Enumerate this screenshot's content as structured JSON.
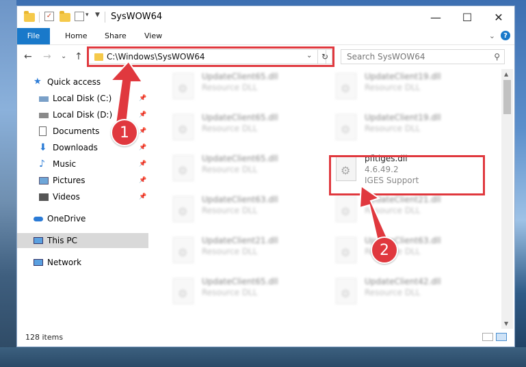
{
  "window": {
    "title": "SysWOW64",
    "minimize": "—",
    "maximize": "☐",
    "close": "✕"
  },
  "ribbon": {
    "tabs": [
      "File",
      "Home",
      "Share",
      "View"
    ],
    "expand": "⌄",
    "help": "?"
  },
  "nav": {
    "back": "←",
    "forward": "→",
    "recent": "⌄",
    "up": "↑",
    "address": "C:\\Windows\\SysWOW64",
    "address_dropdown": "⌄",
    "refresh": "↻",
    "search_placeholder": "Search SysWOW64",
    "search_icon": "⚲"
  },
  "sidebar": {
    "items": [
      {
        "label": "Quick access",
        "icon": "star-icon",
        "pinned": false
      },
      {
        "label": "Local Disk (C:)",
        "icon": "drive-icon",
        "pinned": true
      },
      {
        "label": "Local Disk (D:)",
        "icon": "drive-icon",
        "pinned": true
      },
      {
        "label": "Documents",
        "icon": "documents-icon",
        "pinned": true
      },
      {
        "label": "Downloads",
        "icon": "downloads-icon",
        "pinned": true
      },
      {
        "label": "Music",
        "icon": "music-icon",
        "pinned": true
      },
      {
        "label": "Pictures",
        "icon": "pictures-icon",
        "pinned": true
      },
      {
        "label": "Videos",
        "icon": "videos-icon",
        "pinned": true
      },
      {
        "label": "OneDrive",
        "icon": "onedrive-icon",
        "pinned": false
      },
      {
        "label": "This PC",
        "icon": "computer-icon",
        "pinned": false,
        "selected": true
      },
      {
        "label": "Network",
        "icon": "network-icon",
        "pinned": false
      }
    ],
    "pin_glyph": "📌"
  },
  "files": {
    "left_column": [
      {
        "name": "UpdateClient65.dll",
        "type": "Resource DLL"
      },
      {
        "name": "UpdateClient65.dll",
        "type": "Resource DLL"
      },
      {
        "name": "UpdateClient65.dll",
        "type": "Resource DLL"
      },
      {
        "name": "UpdateClient63.dll",
        "type": "Resource DLL"
      },
      {
        "name": "UpdateClient21.dll",
        "type": "Resource DLL"
      },
      {
        "name": "UpdateClient65.dll",
        "type": "Resource DLL"
      }
    ],
    "right_column": [
      {
        "name": "UpdateClient19.dll",
        "type": "Resource DLL"
      },
      {
        "name": "UpdateClient19.dll",
        "type": "Resource DLL"
      },
      {
        "name": "UpdateClient21.dll",
        "type": "Resource DLL"
      },
      {
        "name": "UpdateClient63.dll",
        "type": "Resource DLL"
      },
      {
        "name": "UpdateClient42.dll",
        "type": "Resource DLL"
      }
    ],
    "highlighted": {
      "name": "pfltiges.dll",
      "version": "4.6.49.2",
      "description": "IGES Support"
    }
  },
  "status": {
    "item_count": "128 items"
  },
  "annotations": {
    "step1": "1",
    "step2": "2"
  },
  "colors": {
    "accent": "#1979ca",
    "highlight": "#e0383e"
  }
}
